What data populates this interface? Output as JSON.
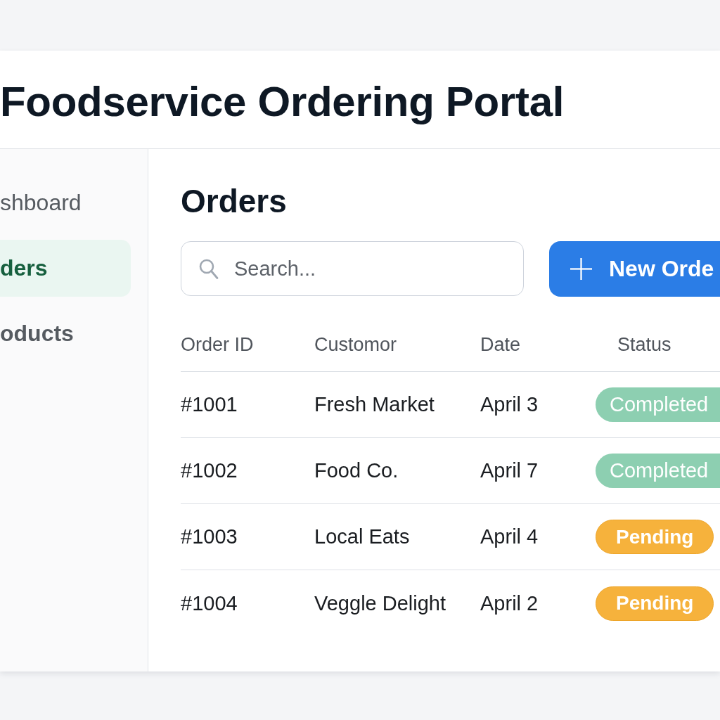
{
  "header": {
    "title": "Foodservice Ordering Portal"
  },
  "sidebar": {
    "items": [
      {
        "label": "shboard",
        "selected": false
      },
      {
        "label": "ders",
        "selected": true
      },
      {
        "label": "oducts",
        "selected": false
      }
    ]
  },
  "main": {
    "heading": "Orders",
    "search": {
      "placeholder": "Search..."
    },
    "new_button": {
      "label": "New Orde"
    }
  },
  "table": {
    "columns": [
      "Order ID",
      "Customor",
      "Date",
      "Status"
    ],
    "rows": [
      {
        "id": "#1001",
        "customer": "Fresh Market",
        "date": "April 3",
        "status": {
          "label": "Completed",
          "kind": "completed"
        }
      },
      {
        "id": "#1002",
        "customer": "Food Co.",
        "date": "April 7",
        "status": {
          "label": "Completed",
          "kind": "completed"
        }
      },
      {
        "id": "#1003",
        "customer": "Local Eats",
        "date": "April 4",
        "status": {
          "label": "Pending",
          "kind": "pending"
        }
      },
      {
        "id": "#1004",
        "customer": "Veggle Delight",
        "date": "April 2",
        "status": {
          "label": "Pending",
          "kind": "pending"
        }
      }
    ]
  }
}
